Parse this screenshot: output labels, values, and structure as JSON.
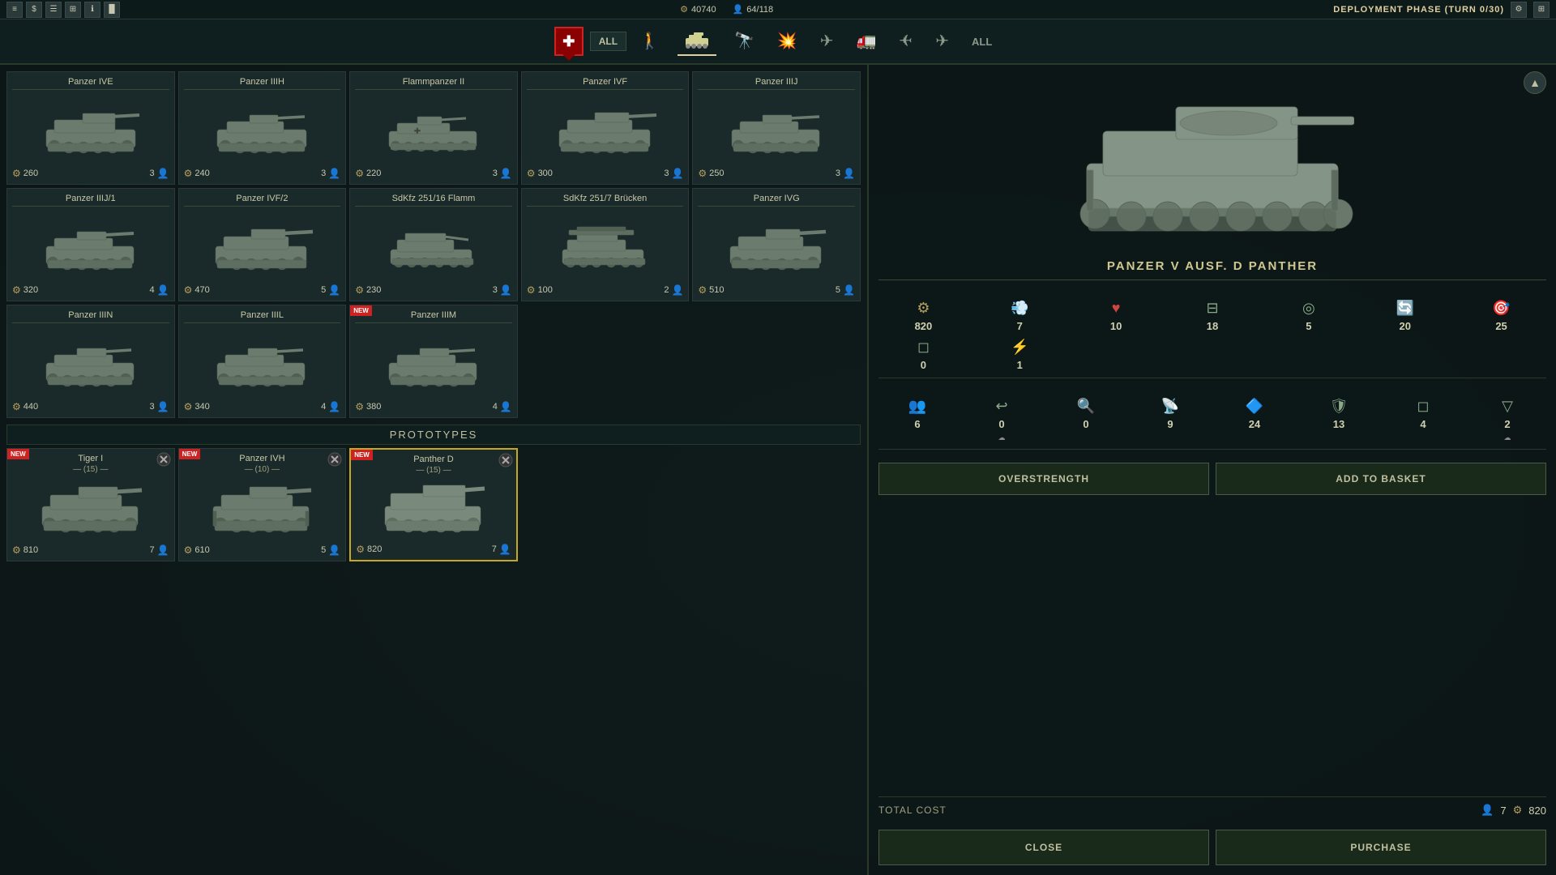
{
  "topbar": {
    "icons": [
      "≡",
      "$",
      "☰",
      "⊞",
      "ℹ",
      "▐▌"
    ],
    "resources": {
      "points": "40740",
      "units_current": "64",
      "units_max": "118"
    },
    "deployment": "DEPLOYMENT PHASE (TURN 0/30)"
  },
  "tabs": [
    {
      "id": "all-faction",
      "label": "ALL",
      "icon": "✚",
      "active": false,
      "faction": true
    },
    {
      "id": "infantry",
      "label": "",
      "icon": "🚶",
      "active": false
    },
    {
      "id": "tanks",
      "label": "",
      "icon": "🛡",
      "active": true
    },
    {
      "id": "recon",
      "label": "",
      "icon": "🔭",
      "active": false
    },
    {
      "id": "artillery",
      "label": "",
      "icon": "💥",
      "active": false
    },
    {
      "id": "aa",
      "label": "",
      "icon": "✈",
      "active": false
    },
    {
      "id": "support",
      "label": "",
      "icon": "⚙",
      "active": false
    },
    {
      "id": "transport",
      "label": "",
      "icon": "🚛",
      "active": false
    },
    {
      "id": "bomber",
      "label": "",
      "icon": "✈",
      "active": false
    },
    {
      "id": "fighter",
      "label": "",
      "icon": "✈",
      "active": false
    },
    {
      "id": "all",
      "label": "ALL",
      "icon": "",
      "active": false
    }
  ],
  "units": [
    {
      "name": "Panzer IVE",
      "cost": 260,
      "slots": 3,
      "new": false
    },
    {
      "name": "Panzer IIIH",
      "cost": 240,
      "slots": 3,
      "new": false
    },
    {
      "name": "Flammpanzer II",
      "cost": 220,
      "slots": 3,
      "new": false
    },
    {
      "name": "Panzer IVF",
      "cost": 300,
      "slots": 3,
      "new": false
    },
    {
      "name": "Panzer IIIJ",
      "cost": 250,
      "slots": 3,
      "new": false
    },
    {
      "name": "Panzer IIIJ/1",
      "cost": 320,
      "slots": 4,
      "new": false
    },
    {
      "name": "Panzer IVF/2",
      "cost": 470,
      "slots": 5,
      "new": false
    },
    {
      "name": "SdKfz 251/16 Flamm",
      "cost": 230,
      "slots": 3,
      "new": false
    },
    {
      "name": "SdKfz 251/7 Brücken",
      "cost": 100,
      "slots": 2,
      "new": false
    },
    {
      "name": "Panzer IVG",
      "cost": 510,
      "slots": 5,
      "new": false
    },
    {
      "name": "Panzer IIIN",
      "cost": 440,
      "slots": 3,
      "new": false
    },
    {
      "name": "Panzer IIIL",
      "cost": 340,
      "slots": 4,
      "new": false
    },
    {
      "name": "Panzer IIIM",
      "cost": 380,
      "slots": 4,
      "new": true
    }
  ],
  "prototypes_label": "PROTOTYPES",
  "prototypes": [
    {
      "name": "Tiger I",
      "quantity": 15,
      "cost": 810,
      "slots": 7,
      "new": true,
      "selected": false
    },
    {
      "name": "Panzer IVH",
      "quantity": 10,
      "cost": 610,
      "slots": 5,
      "new": true,
      "selected": false
    },
    {
      "name": "Panther D",
      "quantity": 15,
      "cost": 820,
      "slots": 7,
      "new": true,
      "selected": true
    }
  ],
  "detail": {
    "unit_name": "PANZER V AUSF. D  PANTHER",
    "stats1": [
      {
        "icon": "🛡",
        "value": "820",
        "label": "cost"
      },
      {
        "icon": "💨",
        "value": "7",
        "label": "speed"
      },
      {
        "icon": "❤",
        "value": "10",
        "label": "hp"
      },
      {
        "icon": "🔫",
        "value": "18",
        "label": "attack"
      },
      {
        "icon": "⊞",
        "value": "5",
        "label": "range"
      },
      {
        "icon": "🔄",
        "value": "20",
        "label": "initiative"
      },
      {
        "icon": "🎯",
        "value": "25",
        "label": "accuracy"
      },
      {
        "icon": "◎",
        "value": "0",
        "label": "stealth"
      },
      {
        "icon": "⚡",
        "value": "1",
        "label": "fuel"
      }
    ],
    "stats2": [
      {
        "icon": "👥",
        "value": "6",
        "label": "crew"
      },
      {
        "icon": "↩",
        "value": "0",
        "label": "reverse"
      },
      {
        "icon": "🏠",
        "value": "0",
        "label": "optics"
      },
      {
        "icon": "⚡",
        "value": "9",
        "label": "radio"
      },
      {
        "icon": "🔷",
        "value": "24",
        "label": "front_armor"
      },
      {
        "icon": "🛡",
        "value": "13",
        "label": "side_armor"
      },
      {
        "icon": "◻",
        "value": "4",
        "label": "rear_armor"
      },
      {
        "icon": "◽",
        "value": "2",
        "label": "top_armor"
      },
      {
        "icon": "☁",
        "value": "",
        "label": "smoke"
      }
    ],
    "overstrength_label": "OVERSTRENGTH",
    "add_to_basket_label": "ADD TO BASKET",
    "total_cost_label": "TOTAL COST",
    "total_cost_slots": "7",
    "total_cost_points": "820",
    "close_label": "CLOSE",
    "purchase_label": "PURCHASE"
  }
}
